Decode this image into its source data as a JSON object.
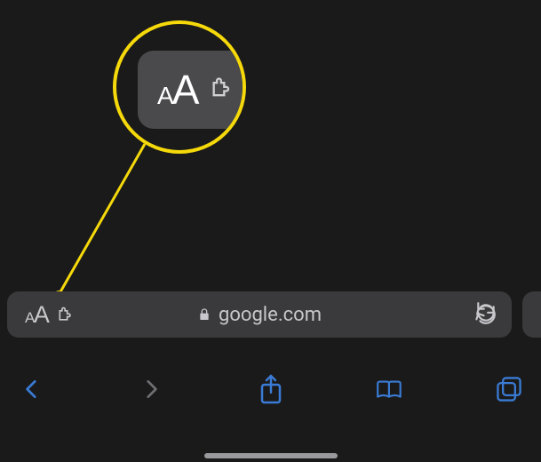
{
  "addressBar": {
    "textSizeIcon": "AA",
    "url": "google.com",
    "secure": true
  },
  "toolbar": {
    "back": "Back",
    "forward": "Forward",
    "share": "Share",
    "bookmarks": "Bookmarks",
    "tabs": "Tabs"
  },
  "callout": {
    "label": "AA"
  }
}
